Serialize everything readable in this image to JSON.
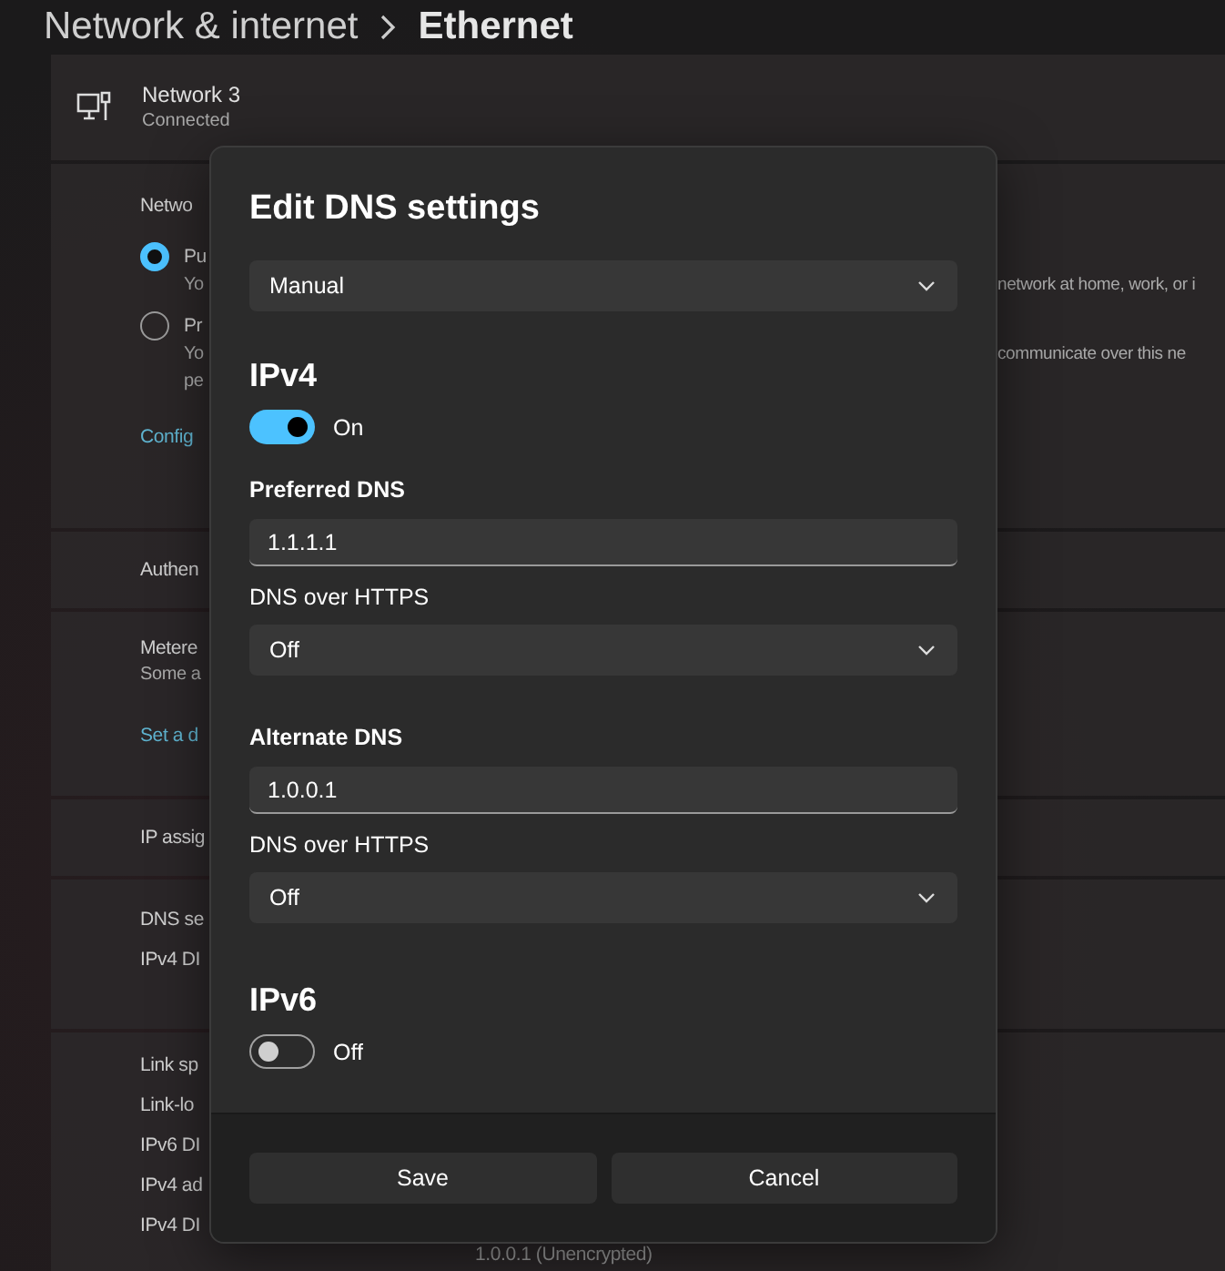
{
  "breadcrumb": {
    "parent": "Network & internet",
    "current": "Ethernet"
  },
  "network": {
    "name": "Network 3",
    "status": "Connected"
  },
  "profile": {
    "label": "Netwo",
    "options": [
      {
        "title": "Pu",
        "selected": true,
        "lines": [
          {
            "start": "Yo",
            "end": "network at home, work, or i"
          }
        ]
      },
      {
        "title": "Pr",
        "selected": false,
        "lines": [
          {
            "start": "Yo",
            "end": "communicate over this ne"
          },
          {
            "start": "pe"
          }
        ]
      }
    ],
    "link": "Config"
  },
  "authentication": {
    "label": "Authen"
  },
  "metered": {
    "label": "Metere",
    "description": "Some a",
    "link": "Set a d"
  },
  "ip_assignment": {
    "label": "IP assig"
  },
  "dns_lines": [
    "DNS se",
    "IPv4 DI"
  ],
  "properties": {
    "lines": [
      "Link sp",
      "Link-lo",
      "IPv6 DI",
      "IPv4 ad",
      "IPv4 DI"
    ],
    "value": "1.0.0.1 (Unencrypted)"
  },
  "dialog": {
    "title": "Edit DNS settings",
    "mode": "Manual",
    "sections": [
      {
        "heading": "IPv4",
        "on": true,
        "state_label": "On",
        "servers": [
          {
            "label": "Preferred DNS",
            "value": "1.1.1.1",
            "doh_label": "DNS over HTTPS",
            "doh_value": "Off"
          },
          {
            "label": "Alternate DNS",
            "value": "1.0.0.1",
            "doh_label": "DNS over HTTPS",
            "doh_value": "Off"
          }
        ]
      },
      {
        "heading": "IPv6",
        "on": false,
        "state_label": "Off"
      }
    ],
    "buttons": [
      {
        "label": "Save"
      },
      {
        "label": "Cancel"
      }
    ]
  }
}
